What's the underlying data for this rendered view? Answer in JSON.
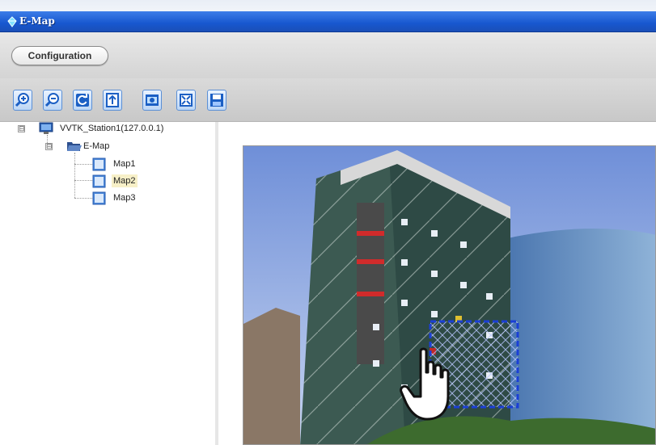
{
  "window": {
    "title": "E-Map",
    "icon": "emap-app-icon"
  },
  "config": {
    "label": "Configuration"
  },
  "toolbar": {
    "buttons": [
      {
        "name": "zoom-in-button",
        "icon": "zoom-in-icon"
      },
      {
        "name": "zoom-out-button",
        "icon": "zoom-out-icon"
      },
      {
        "name": "refresh-button",
        "icon": "refresh-icon"
      },
      {
        "name": "upload-button",
        "icon": "upload-icon"
      },
      {
        "name": "camera-button",
        "icon": "camera-icon"
      },
      {
        "name": "fit-window-button",
        "icon": "fit-window-icon"
      },
      {
        "name": "save-button",
        "icon": "save-icon"
      }
    ]
  },
  "tree": {
    "station": {
      "label": "VVTK_Station1(127.0.0.1)",
      "expander": "⊟"
    },
    "folder": {
      "label": "E-Map",
      "expander": "⊟"
    },
    "maps": [
      {
        "label": "Map1",
        "selected": false
      },
      {
        "label": "Map2",
        "selected": true
      },
      {
        "label": "Map3",
        "selected": false
      }
    ]
  },
  "map": {
    "highlight_color": "#1a3fd6"
  },
  "colors": {
    "titlebar": "#1757cf",
    "toolbar_btn_border": "#5a8fd6",
    "selected": "#f7f0c8"
  }
}
